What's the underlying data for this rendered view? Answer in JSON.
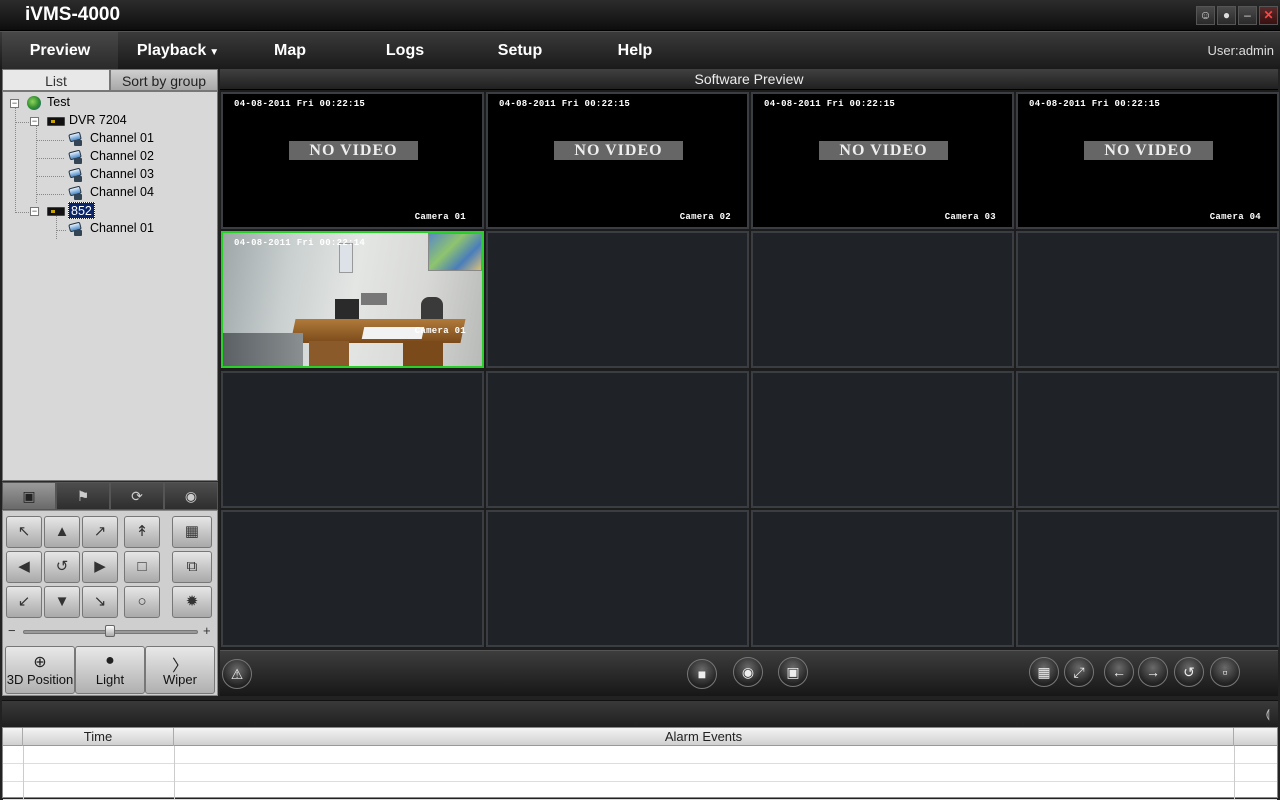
{
  "app": {
    "title": "iVMS-4000"
  },
  "window_buttons": [
    "user-icon",
    "lock-icon",
    "minimize-icon",
    "close-icon"
  ],
  "menu": {
    "items": [
      "Preview",
      "Playback",
      "Map",
      "Logs",
      "Setup",
      "Help"
    ],
    "active": "Preview",
    "user_label": "User:admin"
  },
  "left_tabs": [
    "List",
    "Sort by group"
  ],
  "tree": {
    "root": "Test",
    "devices": [
      {
        "name": "DVR 7204",
        "channels": [
          "Channel 01",
          "Channel 02",
          "Channel 03",
          "Channel 04"
        ]
      },
      {
        "name": "852",
        "channels": [
          "Channel 01"
        ]
      }
    ]
  },
  "ptz": {
    "tabs": [
      "ptz-control-icon",
      "preset-icon",
      "patrol-icon",
      "color-icon"
    ],
    "slider_min": "−",
    "slider_max": "+",
    "slider_level": 0.5,
    "function_buttons": [
      "3D Position",
      "Light",
      "Wiper"
    ]
  },
  "preview": {
    "title": "Software Preview",
    "cells": [
      {
        "date": "04-08-2011 Fri 00:22:15",
        "status": "NO VIDEO",
        "camera": "Camera 01"
      },
      {
        "date": "04-08-2011 Fri 00:22:15",
        "status": "NO VIDEO",
        "camera": "Camera 02"
      },
      {
        "date": "04-08-2011 Fri 00:22:15",
        "status": "NO VIDEO",
        "camera": "Camera 03"
      },
      {
        "date": "04-08-2011 Fri 00:22:15",
        "status": "NO VIDEO",
        "camera": "Camera 04"
      },
      {
        "date": "04-08-2011 Fri 00:22:14",
        "status": "",
        "camera": "Camera 01"
      }
    ]
  },
  "toolbar": {
    "left": [
      "alarm-icon"
    ],
    "center": [
      "stop-all-icon",
      "record-icon",
      "capture-icon"
    ],
    "right": [
      "layout-icon",
      "fullscreen-icon",
      "previous-icon",
      "next-icon",
      "cycle-icon",
      "window-icon"
    ]
  },
  "alarms": {
    "columns": [
      "Time",
      "Alarm Events"
    ]
  },
  "colors": {
    "selected_border": "#2ad02a",
    "background": "#222222"
  }
}
